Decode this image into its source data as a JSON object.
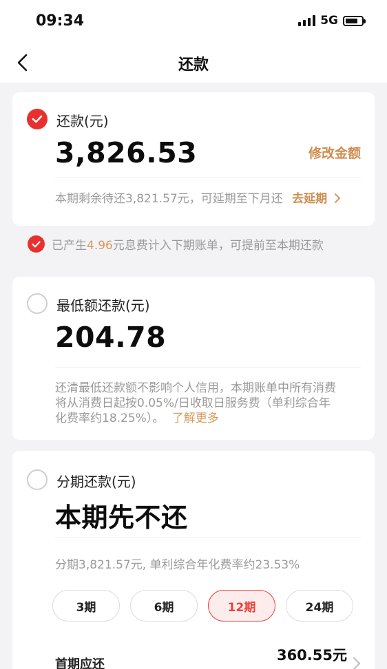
{
  "status_bar": {
    "time": "09:34",
    "network": "5G"
  },
  "nav": {
    "title": "还款"
  },
  "full_repay": {
    "label": "还款(元)",
    "amount": "3,826.53",
    "edit_label": "修改金额",
    "desc": "本期剩余待还3,821.57元，可延期至下月还",
    "defer_link": "去延期"
  },
  "interest_notice": {
    "prefix": "已产生",
    "amount": "4.96",
    "suffix": "元息费计入下期账单，可提前至本期还款"
  },
  "min_repay": {
    "label": "最低额还款(元)",
    "amount": "204.78",
    "desc_line1": "还清最低还款额不影响个人信用，本期账单中所有消费",
    "desc_line2": "将从消费日起按0.05%/日收取日服务费（单利综合年",
    "desc_line3": "化费率约18.25%）。",
    "learn_more": "了解更多"
  },
  "installment": {
    "label": "分期还款(元)",
    "headline": "本期先不还",
    "desc": "分期3,821.57元, 单利综合年化费率约23.53%",
    "periods": [
      {
        "label": "3期",
        "selected": false
      },
      {
        "label": "6期",
        "selected": false
      },
      {
        "label": "12期",
        "selected": true
      },
      {
        "label": "24期",
        "selected": false
      }
    ],
    "first_payment_label": "首期应还",
    "first_payment_amount": "360.55元"
  },
  "colors": {
    "accent_red": "#e8312f",
    "accent_orange": "#d08d4f",
    "background": "#f3f3f5"
  }
}
